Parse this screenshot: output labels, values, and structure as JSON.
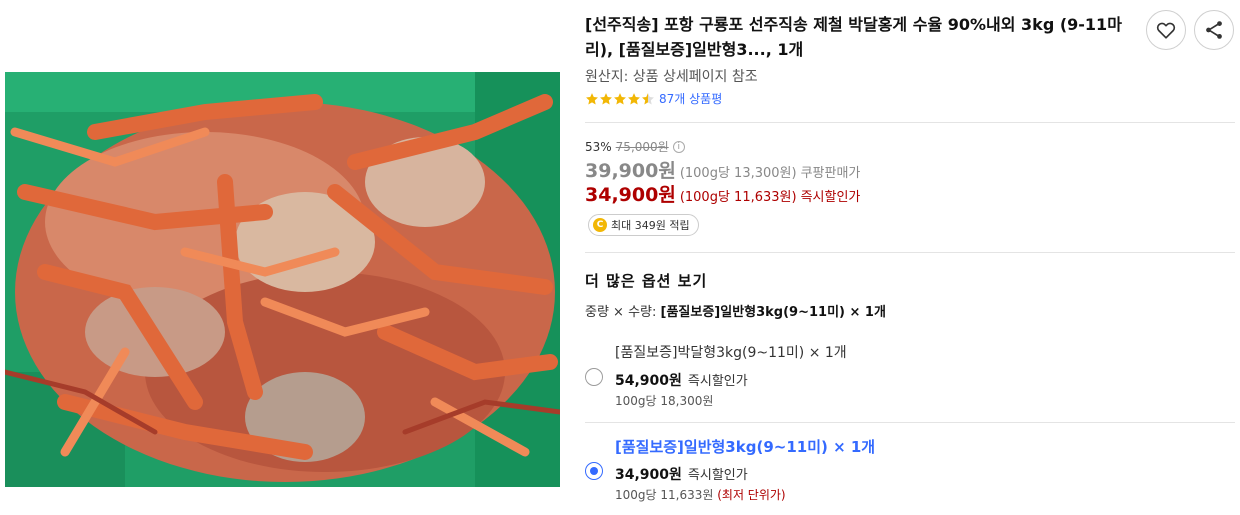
{
  "product": {
    "title": "[선주직송] 포항 구룡포 선주직송 제철 박달홍게 수율 90%내외 3kg (9-11마리), [품질보증]일반형3..., 1개",
    "origin": "원산지: 상품 상세페이지 참조",
    "rating_value": 4.5,
    "review_count_label": "87개 상품평"
  },
  "icons": {
    "wishlist": "heart-icon",
    "share": "share-icon"
  },
  "pricing": {
    "discount_rate": "53%",
    "original_price": "75,000원",
    "coupang_price": "39,900원",
    "coupang_unit": "(100g당 13,300원)",
    "coupang_label": "쿠팡판매가",
    "instant_price": "34,900원",
    "instant_unit": "(100g당 11,633원)",
    "instant_label": "즉시할인가"
  },
  "reward": {
    "coin_label": "C",
    "text": "최대 349원 적립"
  },
  "options": {
    "section_title": "더 많은 옵션 보기",
    "summary_prefix": "중량 × 수량: ",
    "summary_value": "[품질보증]일반형3kg(9~11미) × 1개",
    "items": [
      {
        "name": "[품질보증]박달형3kg(9~11미) × 1개",
        "price": "54,900원",
        "price_label": "즉시할인가",
        "unit": "100g당 18,300원",
        "lowest": "",
        "selected": false
      },
      {
        "name": "[품질보증]일반형3kg(9~11미) × 1개",
        "price": "34,900원",
        "price_label": "즉시할인가",
        "unit": "100g당 11,633원",
        "lowest": "(최저 단위가)",
        "selected": true
      }
    ]
  },
  "colors": {
    "accent": "#346aff",
    "sale_red": "#ae0000",
    "star": "#f2b705",
    "crate_green": "#1d9b63"
  }
}
